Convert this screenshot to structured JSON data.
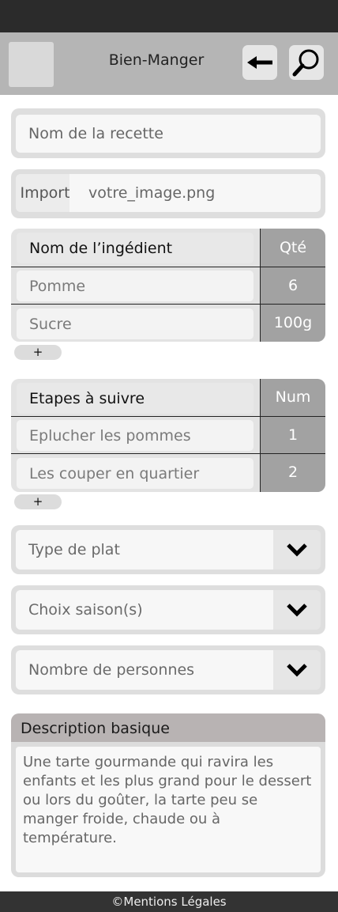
{
  "header": {
    "title": "Bien-Manger"
  },
  "recipe": {
    "name_placeholder": "Nom de la recette",
    "import_label": "Import",
    "import_file": "votre_image.png"
  },
  "ingredients": {
    "header_name": "Nom de l’ingédient",
    "header_qty": "Qté",
    "rows": [
      {
        "name": "Pomme",
        "qty": "6"
      },
      {
        "name": "Sucre",
        "qty": "100g"
      }
    ],
    "add_label": "+"
  },
  "steps": {
    "header_name": "Etapes à suivre",
    "header_num": "Num",
    "rows": [
      {
        "name": "Eplucher les pommes",
        "num": "1"
      },
      {
        "name": "Les couper en quartier",
        "num": "2"
      }
    ],
    "add_label": "+"
  },
  "selects": {
    "dish_type": "Type de plat",
    "season": "Choix saison(s)",
    "people": "Nombre de personnes"
  },
  "description": {
    "title": "Description basique",
    "text": "Une tarte gourmande qui ravira les enfants et les plus grand pour le dessert ou lors du goûter, la tarte peu se manger froide, chaude ou à température."
  },
  "footer": {
    "text": "©Mentions Légales"
  },
  "icons": {
    "back": "arrow-left-icon",
    "search": "magnifier-icon",
    "chevron": "chevron-down-icon"
  }
}
